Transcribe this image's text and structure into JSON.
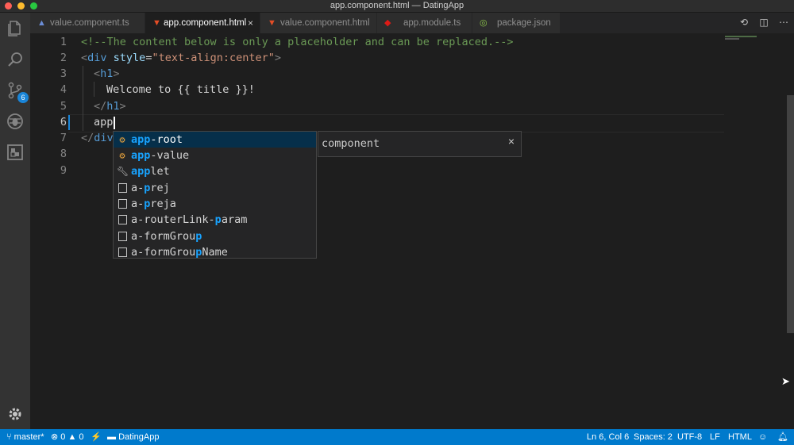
{
  "window": {
    "title": "app.component.html — DatingApp"
  },
  "activity_bar": {
    "items": [
      {
        "icon": "files-icon"
      },
      {
        "icon": "search-icon"
      },
      {
        "icon": "source-control-icon",
        "badge": "6"
      },
      {
        "icon": "debug-icon"
      },
      {
        "icon": "extensions-icon"
      }
    ],
    "manage_icon": "gear-icon"
  },
  "tabs": [
    {
      "label": "value.component.ts",
      "icon": "typescript-angular-icon"
    },
    {
      "label": "app.component.html",
      "icon": "html-icon",
      "active": true,
      "close": "×"
    },
    {
      "label": "value.component.html",
      "icon": "html-icon"
    },
    {
      "label": "app.module.ts",
      "icon": "angular-icon"
    },
    {
      "label": "package.json",
      "icon": "json-icon"
    }
  ],
  "editor": {
    "lines": [
      {
        "num": "1",
        "parts": {
          "comment": "<!--The content below is only a placeholder and can be replaced.-->"
        }
      },
      {
        "num": "2",
        "parts": {
          "open": "<",
          "tag": "div",
          "attr": " style",
          "eq": "=",
          "str": "\"text-align:center\"",
          "close": ">"
        }
      },
      {
        "num": "3",
        "parts": {
          "open": "<",
          "tag": "h1",
          "close": ">"
        }
      },
      {
        "num": "4",
        "parts": {
          "text": "Welcome to {{ title }}!"
        }
      },
      {
        "num": "5",
        "parts": {
          "open": "</",
          "tag": "h1",
          "close": ">"
        }
      },
      {
        "num": "6",
        "parts": {
          "text": "app"
        }
      },
      {
        "num": "7",
        "parts": {
          "open": "</",
          "tag": "div"
        }
      },
      {
        "num": "8",
        "parts": {}
      },
      {
        "num": "9",
        "parts": {}
      }
    ]
  },
  "suggestions": {
    "items": [
      {
        "match": "app",
        "rest": "-root",
        "icon": "component-icon"
      },
      {
        "match": "app",
        "rest": "-value",
        "icon": "component-icon"
      },
      {
        "match": "app",
        "rest": "let",
        "icon": "wrench-icon"
      },
      {
        "pre": "a-",
        "match": "p",
        "rest": "rej",
        "icon": "snippet-icon"
      },
      {
        "pre": "a-",
        "match": "p",
        "rest": "reja",
        "icon": "snippet-icon"
      },
      {
        "pre": "a-routerLink-",
        "match": "p",
        "rest": "aram",
        "icon": "snippet-icon"
      },
      {
        "pre": "a-formGrou",
        "match": "p",
        "rest": "",
        "icon": "snippet-icon"
      },
      {
        "pre": "a-formGrou",
        "match": "p",
        "rest": "Name",
        "icon": "snippet-icon"
      }
    ],
    "detail": {
      "text": "component",
      "close": "×"
    }
  },
  "status_bar": {
    "branch": "master*",
    "errors": "0",
    "warnings": "0",
    "folder": "DatingApp",
    "position": "Ln 6, Col 6",
    "spaces": "Spaces: 2",
    "encoding": "UTF-8",
    "eol": "LF",
    "language": "HTML"
  },
  "colors": {
    "accent": "#007acc",
    "selection": "#062f4a",
    "match_highlight": "#18a3ff"
  }
}
